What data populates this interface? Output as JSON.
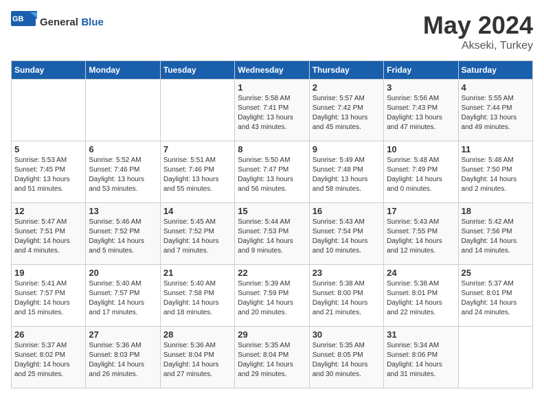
{
  "header": {
    "logo_general": "General",
    "logo_blue": "Blue",
    "title": "May 2024",
    "location": "Akseki, Turkey"
  },
  "days_of_week": [
    "Sunday",
    "Monday",
    "Tuesday",
    "Wednesday",
    "Thursday",
    "Friday",
    "Saturday"
  ],
  "weeks": [
    [
      {
        "day": "",
        "info": ""
      },
      {
        "day": "",
        "info": ""
      },
      {
        "day": "",
        "info": ""
      },
      {
        "day": "1",
        "info": "Sunrise: 5:58 AM\nSunset: 7:41 PM\nDaylight: 13 hours\nand 43 minutes."
      },
      {
        "day": "2",
        "info": "Sunrise: 5:57 AM\nSunset: 7:42 PM\nDaylight: 13 hours\nand 45 minutes."
      },
      {
        "day": "3",
        "info": "Sunrise: 5:56 AM\nSunset: 7:43 PM\nDaylight: 13 hours\nand 47 minutes."
      },
      {
        "day": "4",
        "info": "Sunrise: 5:55 AM\nSunset: 7:44 PM\nDaylight: 13 hours\nand 49 minutes."
      }
    ],
    [
      {
        "day": "5",
        "info": "Sunrise: 5:53 AM\nSunset: 7:45 PM\nDaylight: 13 hours\nand 51 minutes."
      },
      {
        "day": "6",
        "info": "Sunrise: 5:52 AM\nSunset: 7:46 PM\nDaylight: 13 hours\nand 53 minutes."
      },
      {
        "day": "7",
        "info": "Sunrise: 5:51 AM\nSunset: 7:46 PM\nDaylight: 13 hours\nand 55 minutes."
      },
      {
        "day": "8",
        "info": "Sunrise: 5:50 AM\nSunset: 7:47 PM\nDaylight: 13 hours\nand 56 minutes."
      },
      {
        "day": "9",
        "info": "Sunrise: 5:49 AM\nSunset: 7:48 PM\nDaylight: 13 hours\nand 58 minutes."
      },
      {
        "day": "10",
        "info": "Sunrise: 5:48 AM\nSunset: 7:49 PM\nDaylight: 14 hours\nand 0 minutes."
      },
      {
        "day": "11",
        "info": "Sunrise: 5:48 AM\nSunset: 7:50 PM\nDaylight: 14 hours\nand 2 minutes."
      }
    ],
    [
      {
        "day": "12",
        "info": "Sunrise: 5:47 AM\nSunset: 7:51 PM\nDaylight: 14 hours\nand 4 minutes."
      },
      {
        "day": "13",
        "info": "Sunrise: 5:46 AM\nSunset: 7:52 PM\nDaylight: 14 hours\nand 5 minutes."
      },
      {
        "day": "14",
        "info": "Sunrise: 5:45 AM\nSunset: 7:52 PM\nDaylight: 14 hours\nand 7 minutes."
      },
      {
        "day": "15",
        "info": "Sunrise: 5:44 AM\nSunset: 7:53 PM\nDaylight: 14 hours\nand 9 minutes."
      },
      {
        "day": "16",
        "info": "Sunrise: 5:43 AM\nSunset: 7:54 PM\nDaylight: 14 hours\nand 10 minutes."
      },
      {
        "day": "17",
        "info": "Sunrise: 5:43 AM\nSunset: 7:55 PM\nDaylight: 14 hours\nand 12 minutes."
      },
      {
        "day": "18",
        "info": "Sunrise: 5:42 AM\nSunset: 7:56 PM\nDaylight: 14 hours\nand 14 minutes."
      }
    ],
    [
      {
        "day": "19",
        "info": "Sunrise: 5:41 AM\nSunset: 7:57 PM\nDaylight: 14 hours\nand 15 minutes."
      },
      {
        "day": "20",
        "info": "Sunrise: 5:40 AM\nSunset: 7:57 PM\nDaylight: 14 hours\nand 17 minutes."
      },
      {
        "day": "21",
        "info": "Sunrise: 5:40 AM\nSunset: 7:58 PM\nDaylight: 14 hours\nand 18 minutes."
      },
      {
        "day": "22",
        "info": "Sunrise: 5:39 AM\nSunset: 7:59 PM\nDaylight: 14 hours\nand 20 minutes."
      },
      {
        "day": "23",
        "info": "Sunrise: 5:38 AM\nSunset: 8:00 PM\nDaylight: 14 hours\nand 21 minutes."
      },
      {
        "day": "24",
        "info": "Sunrise: 5:38 AM\nSunset: 8:01 PM\nDaylight: 14 hours\nand 22 minutes."
      },
      {
        "day": "25",
        "info": "Sunrise: 5:37 AM\nSunset: 8:01 PM\nDaylight: 14 hours\nand 24 minutes."
      }
    ],
    [
      {
        "day": "26",
        "info": "Sunrise: 5:37 AM\nSunset: 8:02 PM\nDaylight: 14 hours\nand 25 minutes."
      },
      {
        "day": "27",
        "info": "Sunrise: 5:36 AM\nSunset: 8:03 PM\nDaylight: 14 hours\nand 26 minutes."
      },
      {
        "day": "28",
        "info": "Sunrise: 5:36 AM\nSunset: 8:04 PM\nDaylight: 14 hours\nand 27 minutes."
      },
      {
        "day": "29",
        "info": "Sunrise: 5:35 AM\nSunset: 8:04 PM\nDaylight: 14 hours\nand 29 minutes."
      },
      {
        "day": "30",
        "info": "Sunrise: 5:35 AM\nSunset: 8:05 PM\nDaylight: 14 hours\nand 30 minutes."
      },
      {
        "day": "31",
        "info": "Sunrise: 5:34 AM\nSunset: 8:06 PM\nDaylight: 14 hours\nand 31 minutes."
      },
      {
        "day": "",
        "info": ""
      }
    ]
  ]
}
